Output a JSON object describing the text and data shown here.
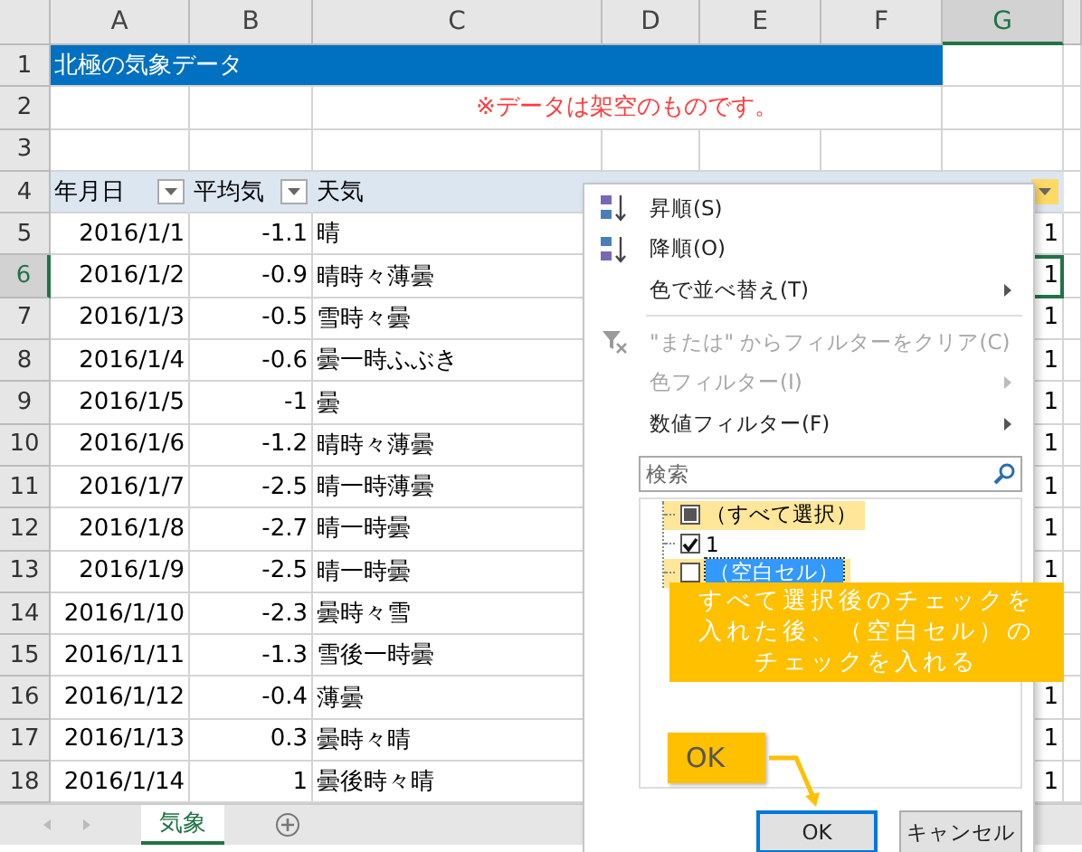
{
  "columns": [
    {
      "label": "A",
      "selected": false
    },
    {
      "label": "B",
      "selected": false
    },
    {
      "label": "C",
      "selected": false
    },
    {
      "label": "D",
      "selected": false
    },
    {
      "label": "E",
      "selected": false
    },
    {
      "label": "F",
      "selected": false
    },
    {
      "label": "G",
      "selected": true
    }
  ],
  "rows": [
    {
      "number": "1",
      "kind": "title",
      "selected": false,
      "text": "北極の気象データ"
    },
    {
      "number": "2",
      "kind": "note",
      "selected": false,
      "text": "※データは架空のものです。"
    },
    {
      "number": "3",
      "kind": "blank",
      "selected": false
    },
    {
      "number": "4",
      "kind": "header",
      "selected": false,
      "cells": [
        {
          "label": "年月日",
          "filter": true
        },
        {
          "label": "平均気",
          "filter": true
        },
        {
          "label": "天気",
          "filter": false
        }
      ],
      "g_filter": {
        "filter": true,
        "highlighted": true
      }
    },
    {
      "number": "5",
      "kind": "data",
      "selected": false,
      "date": "2016/1/1",
      "temp": "-1.1",
      "weather": "晴",
      "column_g": "1",
      "active": false
    },
    {
      "number": "6",
      "kind": "data",
      "selected": true,
      "date": "2016/1/2",
      "temp": "-0.9",
      "weather": "晴時々薄曇",
      "column_g": "1",
      "active": true
    },
    {
      "number": "7",
      "kind": "data",
      "selected": false,
      "date": "2016/1/3",
      "temp": "-0.5",
      "weather": "雪時々曇",
      "column_g": "1",
      "active": false
    },
    {
      "number": "8",
      "kind": "data",
      "selected": false,
      "date": "2016/1/4",
      "temp": "-0.6",
      "weather": "曇一時ふぶき",
      "column_g": "1",
      "active": false
    },
    {
      "number": "9",
      "kind": "data",
      "selected": false,
      "date": "2016/1/5",
      "temp": "-1",
      "weather": "曇",
      "column_g": "1",
      "active": false
    },
    {
      "number": "10",
      "kind": "data",
      "selected": false,
      "date": "2016/1/6",
      "temp": "-1.2",
      "weather": "晴時々薄曇",
      "column_g": "1",
      "active": false
    },
    {
      "number": "11",
      "kind": "data",
      "selected": false,
      "date": "2016/1/7",
      "temp": "-2.5",
      "weather": "晴一時薄曇",
      "column_g": "1",
      "active": false
    },
    {
      "number": "12",
      "kind": "data",
      "selected": false,
      "date": "2016/1/8",
      "temp": "-2.7",
      "weather": "晴一時曇",
      "column_g": "1",
      "active": false
    },
    {
      "number": "13",
      "kind": "data",
      "selected": false,
      "date": "2016/1/9",
      "temp": "-2.5",
      "weather": "晴一時曇",
      "column_g": "1",
      "active": false
    },
    {
      "number": "14",
      "kind": "data",
      "selected": false,
      "date": "2016/1/10",
      "temp": "-2.3",
      "weather": "曇時々雪"
    },
    {
      "number": "15",
      "kind": "data",
      "selected": false,
      "date": "2016/1/11",
      "temp": "-1.3",
      "weather": "雪後一時曇"
    },
    {
      "number": "16",
      "kind": "data",
      "selected": false,
      "date": "2016/1/12",
      "temp": "-0.4",
      "weather": "薄曇",
      "column_g": "1",
      "active": false
    },
    {
      "number": "17",
      "kind": "data",
      "selected": false,
      "date": "2016/1/13",
      "temp": "0.3",
      "weather": "曇時々晴",
      "column_g": "1",
      "active": false
    },
    {
      "number": "18",
      "kind": "data",
      "selected": false,
      "date": "2016/1/14",
      "temp": "1",
      "weather": "曇後時々晴",
      "column_g": "1",
      "active": false
    }
  ],
  "sheet_tabs": [
    {
      "label": "気象",
      "selected": true
    }
  ],
  "filter_menu": {
    "items": [
      {
        "kind": "sort-asc",
        "label": "昇順(S)",
        "disabled": false,
        "submenu": false
      },
      {
        "kind": "sort-desc",
        "label": "降順(O)",
        "disabled": false,
        "submenu": false
      },
      {
        "kind": "plain",
        "label": "色で並べ替え(T)",
        "disabled": false,
        "submenu": true
      },
      {
        "kind": "separator"
      },
      {
        "kind": "clear",
        "label": "\"または\" からフィルターをクリア(C)",
        "disabled": true,
        "submenu": false
      },
      {
        "kind": "plain",
        "label": "色フィルター(I)",
        "disabled": true,
        "submenu": true
      },
      {
        "kind": "plain",
        "label": "数値フィルター(F)",
        "disabled": false,
        "submenu": true
      }
    ],
    "search": {
      "placeholder": "検索"
    },
    "values": [
      {
        "label": "（すべて選択）",
        "checked": false,
        "partial": true,
        "selected": false,
        "highlighted": true
      },
      {
        "label": "1",
        "checked": true,
        "selected": false,
        "highlighted": false
      },
      {
        "label": "（空白セル）",
        "checked": false,
        "selected": true,
        "highlighted": true
      }
    ],
    "buttons": [
      {
        "label": "OK",
        "default": true
      },
      {
        "label": "キャンセル",
        "default": false
      }
    ]
  },
  "callouts": [
    {
      "kind": "note",
      "text": "すべて選択後のチェックを入れた後、（空白セル）のチェックを入れる"
    },
    {
      "kind": "pointer",
      "text": "OK"
    }
  ]
}
